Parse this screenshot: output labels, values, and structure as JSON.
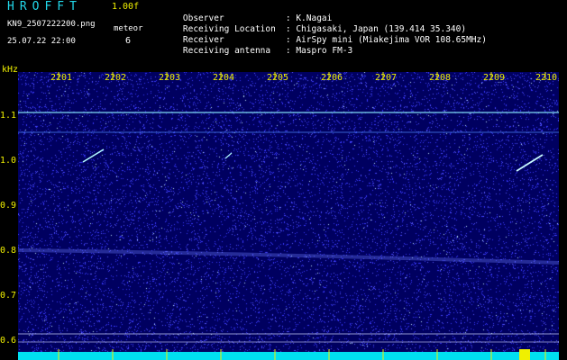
{
  "header": {
    "app_title": "HROFFT",
    "version": "1.00f",
    "file_name": "KN9_2507222200.png",
    "meteor_label": "meteor",
    "timestamp": "25.07.22 22:00",
    "meteor_count": "6"
  },
  "metadata": [
    {
      "label": "Observer",
      "value": ": K.Nagai"
    },
    {
      "label": "Receiving Location",
      "value": ": Chigasaki, Japan (139.414 35.340)"
    },
    {
      "label": "Receiver",
      "value": ": AirSpy mini (Miakejima VOR 108.65MHz)"
    },
    {
      "label": "Receiving antenna",
      "value": ": Maspro FM-3"
    }
  ],
  "spectrogram": {
    "y_unit": "kHz",
    "y_ticks": [
      "1.1",
      "1.0",
      "0.9",
      "0.8",
      "0.7",
      "0.6"
    ],
    "x_ticks": [
      "2201",
      "2202",
      "2203",
      "2204",
      "2205",
      "2206",
      "2207",
      "2208",
      "2209",
      "2210"
    ],
    "colors": {
      "background": "#000060",
      "noise": "#3a3aff",
      "signal": "#7ff0ff",
      "tick": "#f0f000",
      "baseline": "#00e0f0"
    }
  }
}
